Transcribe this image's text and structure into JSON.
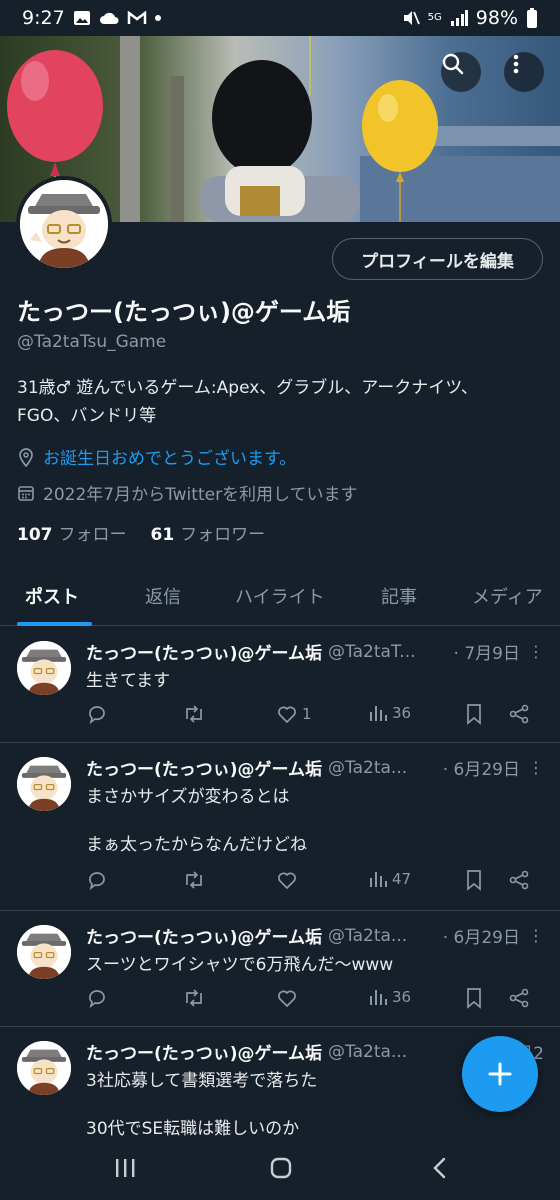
{
  "status": {
    "time": "9:27",
    "battery": "98%",
    "network": "5G"
  },
  "profile": {
    "edit_label": "プロフィールを編集",
    "name": "たっつー(たっつぃ)@ゲーム垢",
    "handle": "@Ta2taTsu_Game",
    "bio_line1": "31歳♂ 遊んでいるゲーム:Apex、グラブル、アークナイツ、",
    "bio_line2": "FGO、バンドリ等",
    "birthday": "お誕生日おめでとうございます。",
    "joined": "2022年7月からTwitterを利用しています",
    "following_count": "107",
    "following_label": "フォロー",
    "followers_count": "61",
    "followers_label": "フォロワー"
  },
  "tabs": [
    "ポスト",
    "返信",
    "ハイライト",
    "記事",
    "メディア"
  ],
  "tweets": [
    {
      "name": "たっつー(たっつぃ)@ゲーム垢",
      "handle": "@Ta2taT...",
      "date": "· 7月9日",
      "text": "生きてます",
      "likes": "1",
      "views": "36"
    },
    {
      "name": "たっつー(たっつぃ)@ゲーム垢",
      "handle": "@Ta2ta...",
      "date": "· 6月29日",
      "text": "まさかサイズが変わるとは\n\nまぁ太ったからなんだけどね",
      "likes": "",
      "views": "47"
    },
    {
      "name": "たっつー(たっつぃ)@ゲーム垢",
      "handle": "@Ta2ta...",
      "date": "· 6月29日",
      "text": "スーツとワイシャツで6万飛んだ〜www",
      "likes": "",
      "views": "36"
    },
    {
      "name": "たっつー(たっつぃ)@ゲーム垢",
      "handle": "@Ta2ta...",
      "date": "· 6月2",
      "text": "3社応募して書類選考で落ちた\n\n30代でSE転職は難しいのか",
      "likes": "",
      "views": ""
    }
  ],
  "icons": {
    "search": "search-icon",
    "more": "more-vertical-icon",
    "location": "location-icon",
    "calendar": "calendar-icon",
    "reply": "reply-icon",
    "retweet": "retweet-icon",
    "like": "heart-icon",
    "views": "views-icon",
    "bookmark": "bookmark-icon",
    "share": "share-icon",
    "compose": "plus-icon"
  },
  "colors": {
    "accent": "#1d9bf0",
    "bg": "#15202b",
    "muted": "#8b98a5"
  }
}
